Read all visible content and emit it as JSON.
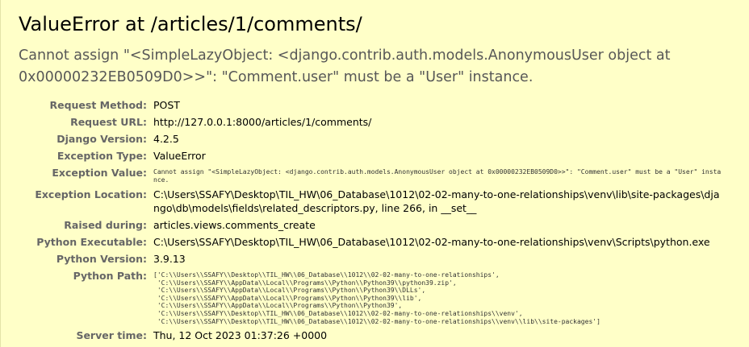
{
  "error": {
    "title": "ValueError at /articles/1/comments/",
    "message": "Cannot assign \"<SimpleLazyObject: <django.contrib.auth.models.AnonymousUser object at 0x00000232EB0509D0>>\": \"Comment.user\" must be a \"User\" instance."
  },
  "meta": {
    "request_method": {
      "label": "Request Method:",
      "value": "POST"
    },
    "request_url": {
      "label": "Request URL:",
      "value": "http://127.0.0.1:8000/articles/1/comments/"
    },
    "django_version": {
      "label": "Django Version:",
      "value": "4.2.5"
    },
    "exception_type": {
      "label": "Exception Type:",
      "value": "ValueError"
    },
    "exception_value": {
      "label": "Exception Value:",
      "value": "Cannot assign \"<SimpleLazyObject: <django.contrib.auth.models.AnonymousUser object at 0x00000232EB0509D0>>\": \"Comment.user\" must be a \"User\" instance."
    },
    "exception_location": {
      "label": "Exception Location:",
      "value": "C:\\Users\\SSAFY\\Desktop\\TIL_HW\\06_Database\\1012\\02-02-many-to-one-relationships\\venv\\lib\\site-packages\\django\\db\\models\\fields\\related_descriptors.py, line 266, in __set__"
    },
    "raised_during": {
      "label": "Raised during:",
      "value": "articles.views.comments_create"
    },
    "python_executable": {
      "label": "Python Executable:",
      "value": "C:\\Users\\SSAFY\\Desktop\\TIL_HW\\06_Database\\1012\\02-02-many-to-one-relationships\\venv\\Scripts\\python.exe"
    },
    "python_version": {
      "label": "Python Version:",
      "value": "3.9.13"
    },
    "python_path": {
      "label": "Python Path:",
      "value": "['C:\\\\Users\\\\SSAFY\\\\Desktop\\\\TIL_HW\\\\06_Database\\\\1012\\\\02-02-many-to-one-relationships',\n 'C:\\\\Users\\\\SSAFY\\\\AppData\\\\Local\\\\Programs\\\\Python\\\\Python39\\\\python39.zip',\n 'C:\\\\Users\\\\SSAFY\\\\AppData\\\\Local\\\\Programs\\\\Python\\\\Python39\\\\DLLs',\n 'C:\\\\Users\\\\SSAFY\\\\AppData\\\\Local\\\\Programs\\\\Python\\\\Python39\\\\lib',\n 'C:\\\\Users\\\\SSAFY\\\\AppData\\\\Local\\\\Programs\\\\Python\\\\Python39',\n 'C:\\\\Users\\\\SSAFY\\\\Desktop\\\\TIL_HW\\\\06_Database\\\\1012\\\\02-02-many-to-one-relationships\\\\venv',\n 'C:\\\\Users\\\\SSAFY\\\\Desktop\\\\TIL_HW\\\\06_Database\\\\1012\\\\02-02-many-to-one-relationships\\\\venv\\\\lib\\\\site-packages']"
    },
    "server_time": {
      "label": "Server time:",
      "value": "Thu, 12 Oct 2023 01:37:26 +0000"
    }
  }
}
